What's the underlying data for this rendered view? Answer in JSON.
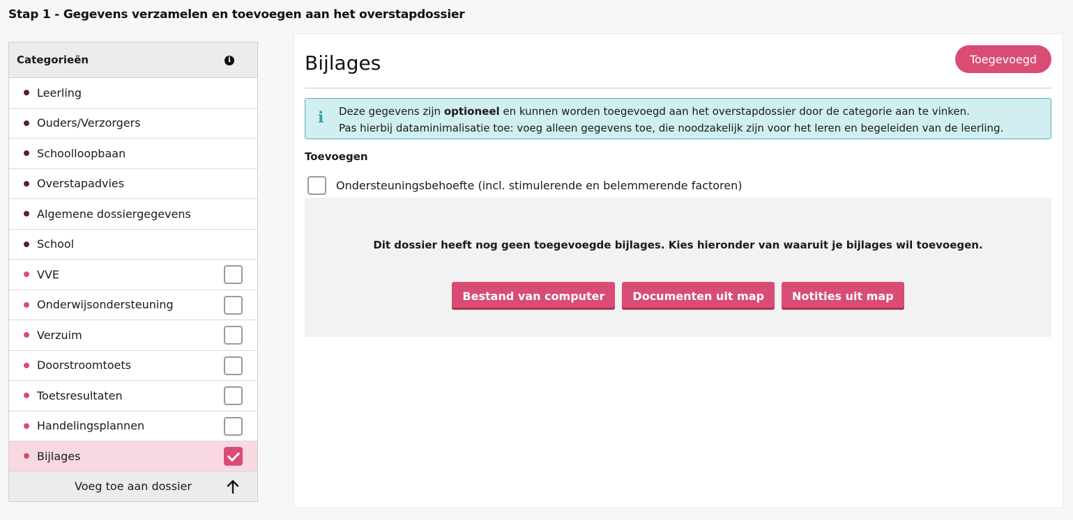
{
  "page": {
    "title": "Stap 1 - Gegevens verzamelen en toevoegen aan het overstapdossier"
  },
  "sidebar": {
    "header": "Categorieën",
    "info_icon": "info-icon",
    "items": [
      {
        "label": "Leerling",
        "bullet": "dark",
        "checkbox": null
      },
      {
        "label": "Ouders/Verzorgers",
        "bullet": "dark",
        "checkbox": null
      },
      {
        "label": "Schoolloopbaan",
        "bullet": "dark",
        "checkbox": null
      },
      {
        "label": "Overstapadvies",
        "bullet": "dark",
        "checkbox": null
      },
      {
        "label": "Algemene dossiergegevens",
        "bullet": "dark",
        "checkbox": null
      },
      {
        "label": "School",
        "bullet": "dark",
        "checkbox": null
      },
      {
        "label": "VVE",
        "bullet": "pink",
        "checkbox": false
      },
      {
        "label": "Onderwijsondersteuning",
        "bullet": "pink",
        "checkbox": false
      },
      {
        "label": "Verzuim",
        "bullet": "pink",
        "checkbox": false
      },
      {
        "label": "Doorstroomtoets",
        "bullet": "pink",
        "checkbox": false
      },
      {
        "label": "Toetsresultaten",
        "bullet": "pink",
        "checkbox": false
      },
      {
        "label": "Handelingsplannen",
        "bullet": "pink",
        "checkbox": false
      },
      {
        "label": "Bijlages",
        "bullet": "pink",
        "checkbox": true,
        "active": true
      }
    ],
    "footer_label": "Voeg toe aan dossier"
  },
  "main": {
    "title": "Bijlages",
    "status_button": "Toegevoegd",
    "info": {
      "line1_pre": "Deze gegevens zijn ",
      "line1_bold": "optioneel",
      "line1_post": " en kunnen worden toegevoegd aan het overstapdossier door de categorie aan te vinken.",
      "line2": "Pas hierbij dataminimalisatie toe: voeg alleen gegevens toe, die noodzakelijk zijn voor het leren en begeleiden van de leerling."
    },
    "section_label": "Toevoegen",
    "option_label": "Ondersteuningsbehoefte (incl. stimulerende en belemmerende factoren)",
    "option_checked": false,
    "empty_message": "Dit dossier heeft nog geen toegevoegde bijlages. Kies hieronder van waaruit je bijlages wil toevoegen.",
    "buttons": [
      "Bestand van computer",
      "Documenten uit map",
      "Notities uit map"
    ]
  },
  "colors": {
    "accent": "#d94c73",
    "bullet_dark": "#5a1b45",
    "info_bg": "#d1eef0",
    "info_border": "#4fb3b8",
    "active_row": "#f8d9e1"
  }
}
